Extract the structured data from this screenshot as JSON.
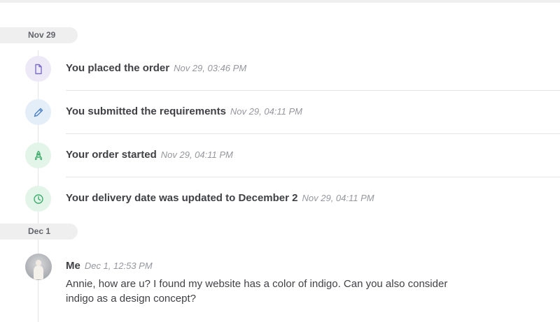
{
  "groups": [
    {
      "date": "Nov 29",
      "events": [
        {
          "icon": "document-icon",
          "title": "You placed the order",
          "time": "Nov 29, 03:46 PM",
          "icon_bg": "#ede9f7",
          "icon_color": "#7b6fc6"
        },
        {
          "icon": "pencil-icon",
          "title": "You submitted the requirements",
          "time": "Nov 29, 04:11 PM",
          "icon_bg": "#e4eef9",
          "icon_color": "#4a7fc6"
        },
        {
          "icon": "rocket-icon",
          "title": "Your order started",
          "time": "Nov 29, 04:11 PM",
          "icon_bg": "#e3f4e9",
          "icon_color": "#3fae6e"
        },
        {
          "icon": "clock-icon",
          "title": "Your delivery date was updated to December 2",
          "time": "Nov 29, 04:11 PM",
          "icon_bg": "#e3f4e9",
          "icon_color": "#3fae6e"
        }
      ]
    },
    {
      "date": "Dec 1",
      "message": {
        "sender": "Me",
        "time": "Dec 1, 12:53 PM",
        "text": "Annie, how are u? I found my website has a color of indigo. Can you also consider indigo as a design concept?"
      }
    }
  ]
}
